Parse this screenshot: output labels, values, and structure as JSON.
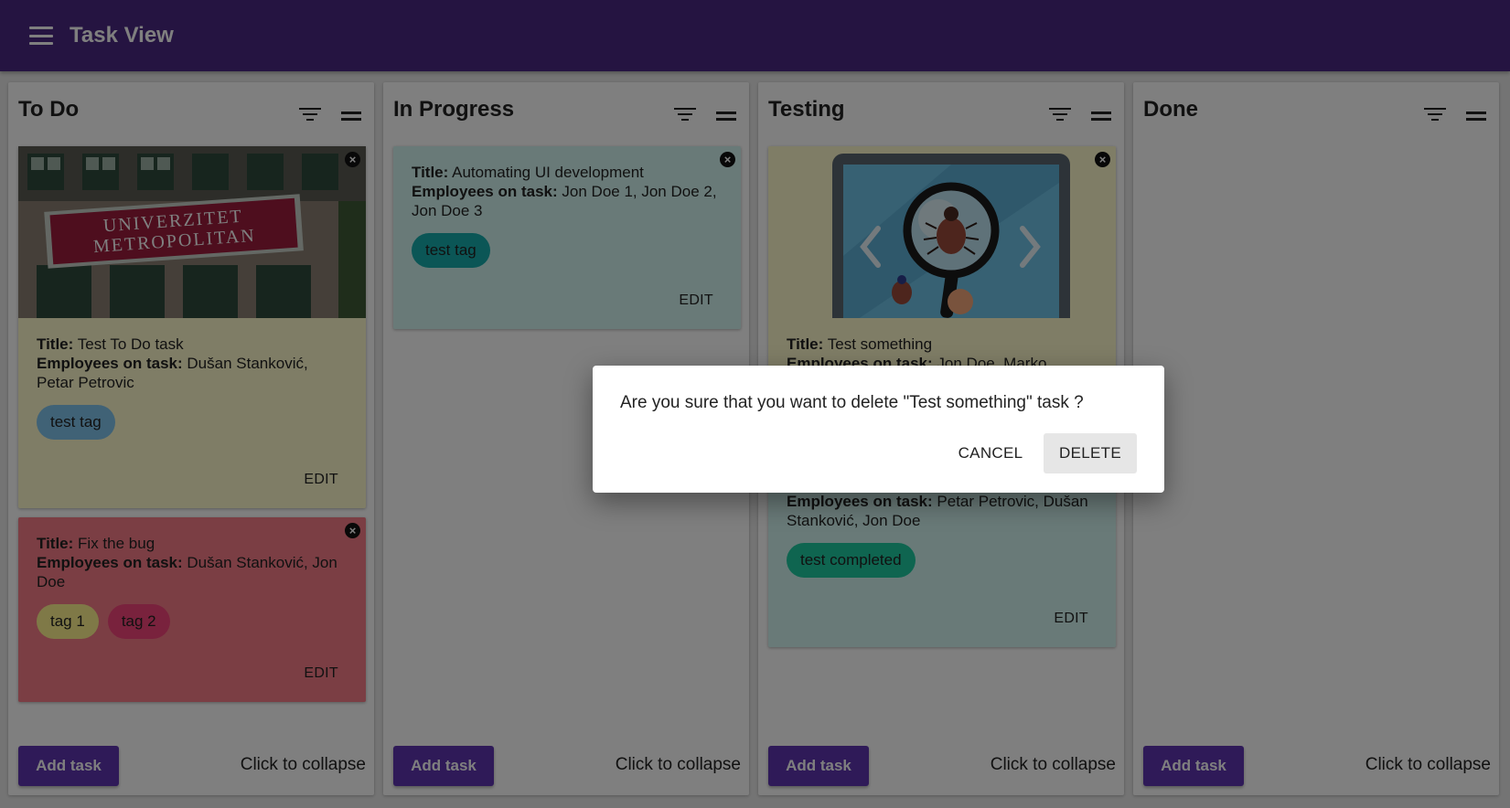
{
  "appbar": {
    "title": "Task View",
    "menu_icon": "menu-icon"
  },
  "colors": {
    "appbar": "#4b2883",
    "button": "#5e35b1",
    "card_yellow": "#fffacd",
    "card_red": "#f77d89",
    "card_teal": "#d3f5f0"
  },
  "columns": [
    {
      "title": "To Do",
      "add_label": "Add task",
      "collapse_label": "Click to collapse",
      "cards": [
        {
          "image": "university-building",
          "sign_line1": "UNIVERZITET",
          "sign_line2": "METROPOLITAN",
          "title_label": "Title:",
          "title": "Test To Do task",
          "employees_label": "Employees on task:",
          "employees": "Dušan Stanković, Petar Petrovic",
          "tags": [
            "test tag"
          ],
          "edit_label": "EDIT"
        },
        {
          "title_label": "Title:",
          "title": "Fix the bug",
          "employees_label": "Employees on task:",
          "employees": "Dušan Stanković, Jon Doe",
          "tags": [
            "tag 1",
            "tag 2"
          ],
          "edit_label": "EDIT"
        }
      ]
    },
    {
      "title": "In Progress",
      "add_label": "Add task",
      "collapse_label": "Click to collapse",
      "cards": [
        {
          "title_label": "Title:",
          "title": "Automating UI development",
          "employees_label": "Employees on task:",
          "employees": "Jon Doe 1, Jon Doe 2, Jon Doe 3",
          "tags": [
            "test tag"
          ],
          "edit_label": "EDIT"
        }
      ]
    },
    {
      "title": "Testing",
      "add_label": "Add task",
      "collapse_label": "Click to collapse",
      "cards": [
        {
          "image": "bug-magnifier-illustration",
          "title_label": "Title:",
          "title": "Test something",
          "employees_label": "Employees on task:",
          "employees": "Jon Doe, Marko",
          "edit_label": "EDIT"
        },
        {
          "employees_label": "Employees on task:",
          "employees": "Petar Petrovic, Dušan Stanković, Jon Doe",
          "tags": [
            "test completed"
          ],
          "edit_label": "EDIT"
        }
      ]
    },
    {
      "title": "Done",
      "add_label": "Add task",
      "collapse_label": "Click to collapse",
      "cards": []
    }
  ],
  "dialog": {
    "message": "Are you sure that you want to delete \"Test something\" task ?",
    "cancel_label": "CANCEL",
    "delete_label": "DELETE"
  }
}
